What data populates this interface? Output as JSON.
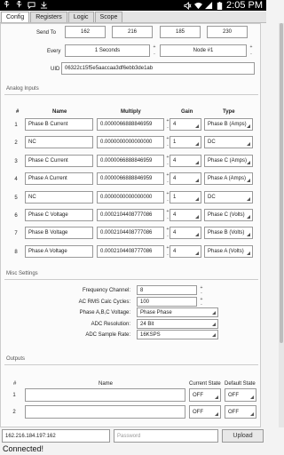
{
  "statusbar": {
    "time": "2:05 PM"
  },
  "tabs": [
    "Config",
    "Registers",
    "Logic",
    "Scope"
  ],
  "send": {
    "label": "Send To",
    "ip": [
      "162",
      "216",
      "185",
      "230"
    ],
    "every_label": "Every",
    "interval": "1 Seconds",
    "node": "Node #1"
  },
  "uid": {
    "label": "UID",
    "value": "06322c15f5e5aaccaa3df6ebb3de1ab"
  },
  "analog": {
    "title": "Analog Inputs",
    "headers": {
      "num": "#",
      "name": "Name",
      "multiply": "Multiply",
      "gain": "Gain",
      "type": "Type"
    },
    "rows": [
      {
        "num": "1",
        "name": "Phase B Current",
        "multiply": "0.0000066888846959",
        "gain": "4",
        "type": "Phase B (Amps)"
      },
      {
        "num": "2",
        "name": "NC",
        "multiply": "0.0000000000000000",
        "gain": "1",
        "type": "DC"
      },
      {
        "num": "3",
        "name": "Phase C Current",
        "multiply": "0.0000066888846959",
        "gain": "4",
        "type": "Phase C (Amps)"
      },
      {
        "num": "4",
        "name": "Phase A Current",
        "multiply": "0.0000066888846959",
        "gain": "4",
        "type": "Phase A (Amps)"
      },
      {
        "num": "5",
        "name": "NC",
        "multiply": "0.0000000000000000",
        "gain": "1",
        "type": "DC"
      },
      {
        "num": "6",
        "name": "Phase C Voltage",
        "multiply": "0.0002104408777086",
        "gain": "4",
        "type": "Phase C (Volts)"
      },
      {
        "num": "7",
        "name": "Phase B Voltage",
        "multiply": "0.0002104408777086",
        "gain": "4",
        "type": "Phase B (Volts)"
      },
      {
        "num": "8",
        "name": "Phase A Voltage",
        "multiply": "0.0002104408777086",
        "gain": "4",
        "type": "Phase A (Volts)"
      }
    ]
  },
  "misc": {
    "title": "Misc Settings",
    "items": [
      {
        "label": "Frequency Channel:",
        "value": "8",
        "kind": "spin"
      },
      {
        "label": "AC RMS Calc Cycles:",
        "value": "100",
        "kind": "spin"
      },
      {
        "label": "Phase A,B,C Voltage:",
        "value": "Phase Phase",
        "kind": "select"
      },
      {
        "label": "ADC Resolution:",
        "value": "24 Bit",
        "kind": "select"
      },
      {
        "label": "ADC Sample Rate:",
        "value": "16KSPS",
        "kind": "select"
      }
    ]
  },
  "outputs": {
    "title": "Outputs",
    "headers": {
      "num": "#",
      "name": "Name",
      "current": "Current State",
      "default": "Default State"
    },
    "rows": [
      {
        "num": "1",
        "name": "",
        "current": "OFF",
        "default": "OFF"
      },
      {
        "num": "2",
        "name": "",
        "current": "OFF",
        "default": "OFF"
      }
    ]
  },
  "footer": {
    "ip_value": "162.216.184.197:162",
    "password_placeholder": "Password",
    "upload_label": "Upload",
    "status": "Connected!"
  }
}
